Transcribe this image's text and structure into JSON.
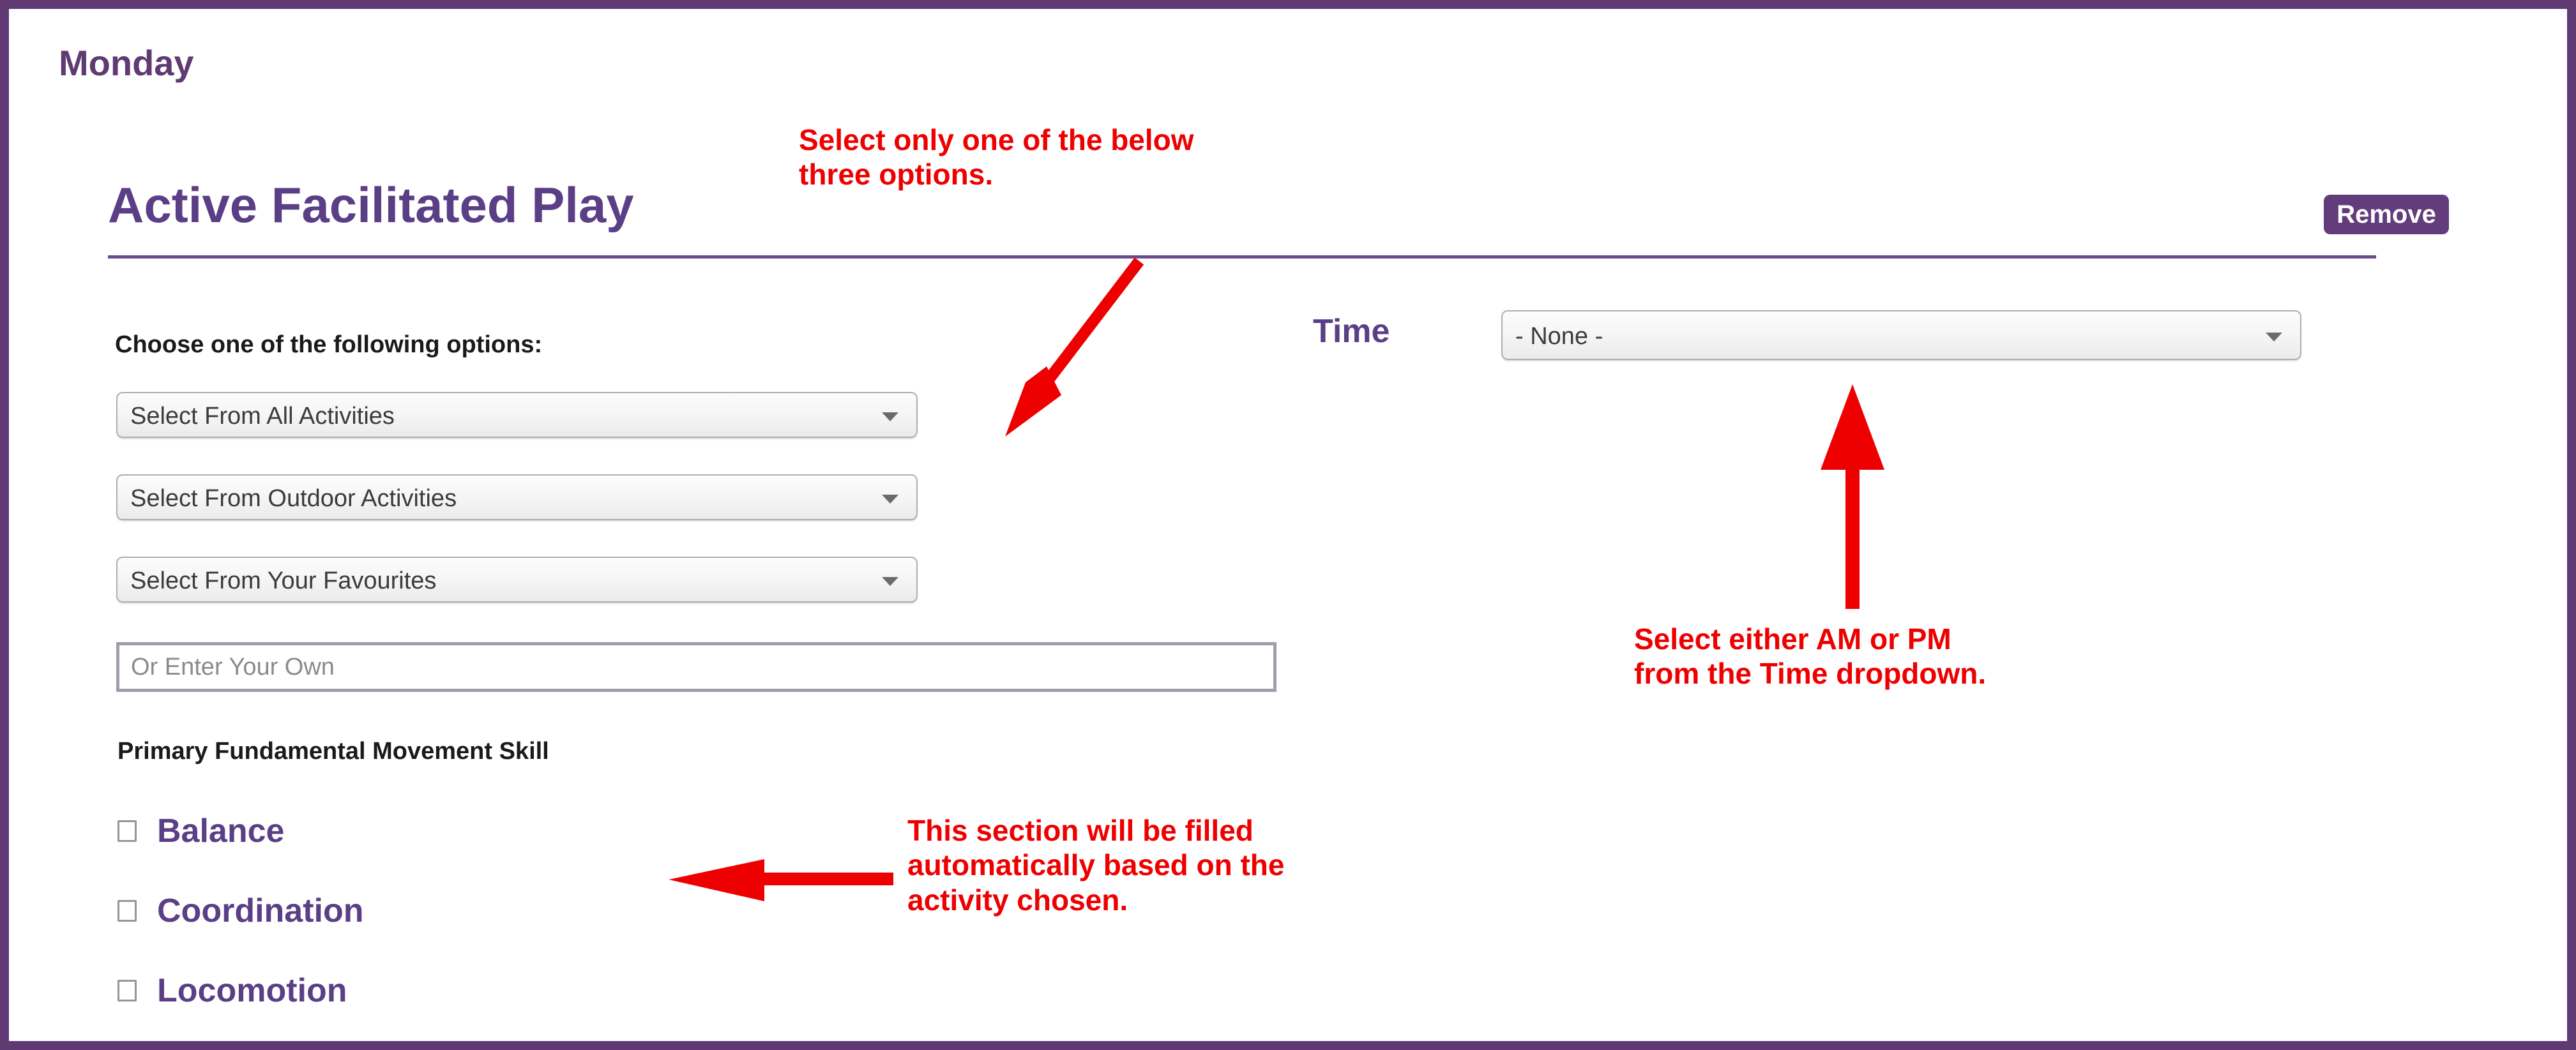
{
  "frame": {
    "border_color": "#5f3a73"
  },
  "day": {
    "label": "Monday"
  },
  "section": {
    "title": "Active Facilitated Play",
    "rule_color": "#6d4a8d",
    "remove_label": "Remove",
    "remove_color": "#633c7c"
  },
  "left_column": {
    "choose_label": "Choose one of the following options:",
    "selects": [
      {
        "name": "select-from-all-activities",
        "value": "Select From All Activities"
      },
      {
        "name": "select-from-outdoor-activities",
        "value": "Select From Outdoor Activities"
      },
      {
        "name": "select-from-your-favourites",
        "value": "Select From Your Favourites"
      }
    ],
    "own_input": {
      "placeholder": "Or Enter Your Own",
      "value": ""
    },
    "pfms_label": "Primary Fundamental Movement Skill",
    "skills": [
      {
        "label": "Balance",
        "checked": false
      },
      {
        "label": "Coordination",
        "checked": false
      },
      {
        "label": "Locomotion",
        "checked": false
      }
    ]
  },
  "right_column": {
    "time_label": "Time",
    "time_select": {
      "value": "- None -"
    }
  },
  "annotations": {
    "color": "#ee0000",
    "top": "Select  only one of the below\nthree options.",
    "time": "Select either AM or PM\nfrom the Time dropdown.",
    "auto_fill": "This section will be filled\nautomatically based on the\nactivity chosen."
  }
}
